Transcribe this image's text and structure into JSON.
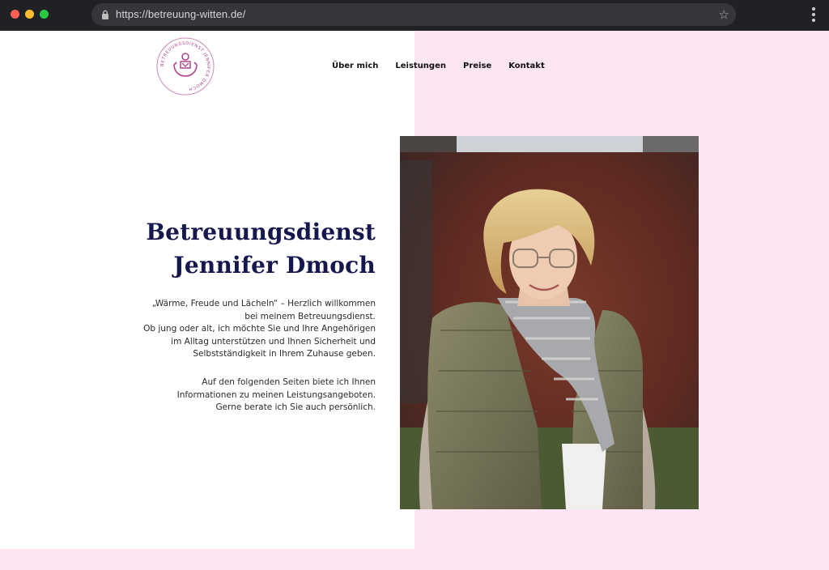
{
  "browser": {
    "url": "https://betreuung-witten.de/"
  },
  "colors": {
    "pink_background": "#fde5f3",
    "title_navy": "#15174d",
    "logo_magenta": "#b0478f"
  },
  "logo": {
    "ring_text": "BETREUUNGSDIENST JENNIFER DMOCH"
  },
  "nav": {
    "items": [
      {
        "label": "Über mich"
      },
      {
        "label": "Leistungen"
      },
      {
        "label": "Preise"
      },
      {
        "label": "Kontakt"
      }
    ]
  },
  "hero": {
    "title_line1": "Betreuungsdienst",
    "title_line2": "Jennifer Dmoch",
    "intro_lines": [
      "„Wärme, Freude und Lächeln“ – Herzlich willkommen",
      "bei meinem Betreuungsdienst.",
      "Ob jung oder alt, ich möchte Sie und Ihre Angehörigen",
      "im Alltag unterstützen und Ihnen Sicherheit und",
      "Selbstständigkeit in Ihrem Zuhause geben."
    ],
    "info_lines": [
      "Auf den folgenden Seiten biete ich Ihnen",
      "Informationen zu meinen Leistungsangeboten.",
      "Gerne berate ich Sie auch persönlich."
    ]
  }
}
